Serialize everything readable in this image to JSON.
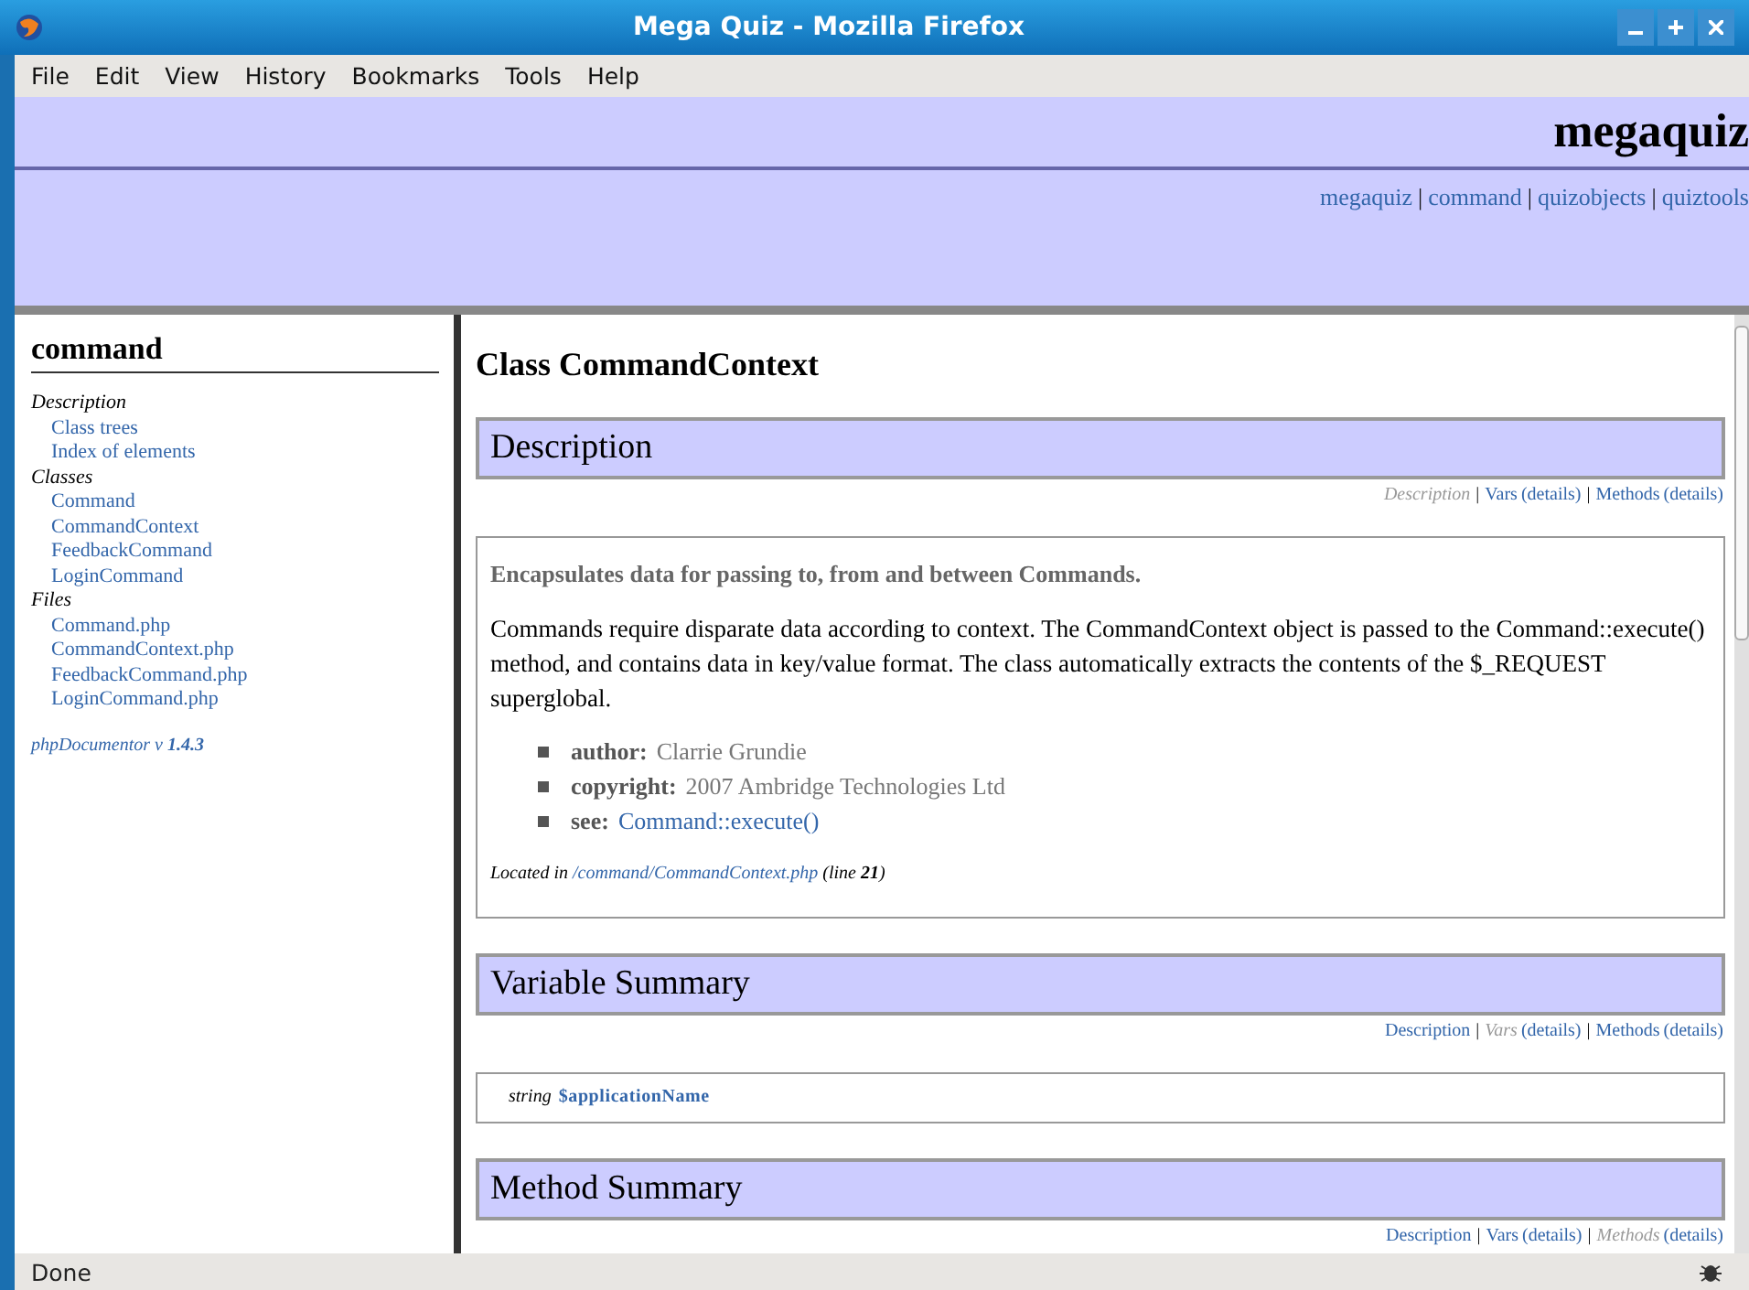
{
  "window": {
    "title": "Mega Quiz - Mozilla Firefox"
  },
  "menu": [
    "File",
    "Edit",
    "View",
    "History",
    "Bookmarks",
    "Tools",
    "Help"
  ],
  "header": {
    "title": "megaquiz",
    "links": [
      {
        "label": "megaquiz"
      },
      {
        "label": "command",
        "sep": "|"
      },
      {
        "label": "quizobjects",
        "sep": "|"
      },
      {
        "label": "quiztools",
        "sep": "|"
      }
    ]
  },
  "sidebar": {
    "title": "command",
    "groups": [
      {
        "heading": "Description",
        "items": [
          "Class trees",
          "Index of elements"
        ]
      },
      {
        "heading": "Classes",
        "items": [
          "Command",
          "CommandContext",
          "FeedbackCommand",
          "LoginCommand"
        ]
      },
      {
        "heading": "Files",
        "items": [
          "Command.php",
          "CommandContext.php",
          "FeedbackCommand.php",
          "LoginCommand.php"
        ]
      }
    ],
    "footer": "phpDocumentor v **1.4.3**"
  },
  "page_title": "Class CommandContext",
  "sections": [
    {
      "kind": "description",
      "heading": "Description",
      "nav": [
        {
          "label": "Description",
          "selected": true
        },
        {
          "sep": "|",
          "label": "Vars",
          "selected": false,
          "details": "(details)"
        },
        {
          "sep": "|",
          "label": "Methods",
          "selected": false,
          "details": "(details)"
        }
      ],
      "summary": "Encapsulates data for passing to, from and between Commands.",
      "text": "Commands require disparate data according to context. The CommandContext object is passed to the Command::execute() method, and contains data in key/value format. The class automatically extracts the contents of the $_REQUEST superglobal.",
      "tags": [
        {
          "name": "author:",
          "value": "Clarrie Grundie",
          "kind": "text"
        },
        {
          "name": "copyright:",
          "value": "2007 Ambridge Technologies Ltd",
          "kind": "text"
        },
        {
          "name": "see:",
          "value": "Command::execute()",
          "kind": "link"
        }
      ],
      "located": {
        "prefix": "Located in",
        "path": "/command/CommandContext.php",
        "suffix": "(line **21**)"
      }
    },
    {
      "kind": "variables",
      "heading": "Variable Summary",
      "nav": [
        {
          "label": "Description",
          "selected": false
        },
        {
          "sep": "|",
          "label": "Vars",
          "selected": true,
          "details": "(details)"
        },
        {
          "sep": "|",
          "label": "Methods",
          "selected": false,
          "details": "(details)"
        }
      ],
      "vars": [
        {
          "type": "string",
          "name": "$applicationName"
        }
      ]
    },
    {
      "kind": "methods",
      "heading": "Method Summary",
      "nav": [
        {
          "label": "Description",
          "selected": false
        },
        {
          "sep": "|",
          "label": "Vars",
          "selected": false,
          "details": "(details)"
        },
        {
          "sep": "|",
          "label": "Methods",
          "selected": true,
          "details": "(details)"
        }
      ]
    }
  ],
  "status_bar": {
    "text": "Done"
  }
}
